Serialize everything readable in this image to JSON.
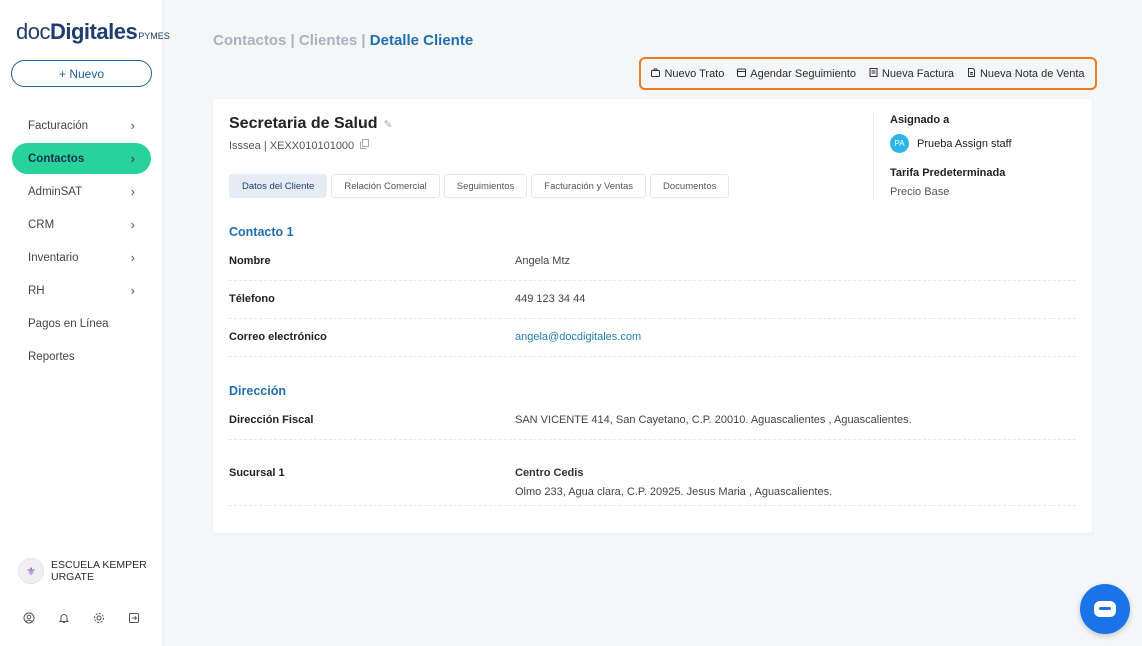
{
  "sidebar": {
    "logo": {
      "doc": "doc",
      "digitales": "Digitales",
      "pymes": "PYMES"
    },
    "new_button": "+ Nuevo",
    "items": [
      {
        "label": "Facturación",
        "chevron": "›"
      },
      {
        "label": "Contactos",
        "chevron": "›"
      },
      {
        "label": "AdminSAT",
        "chevron": "›"
      },
      {
        "label": "CRM",
        "chevron": "›"
      },
      {
        "label": "Inventario",
        "chevron": "›"
      },
      {
        "label": "RH",
        "chevron": "›"
      },
      {
        "label": "Pagos en Línea",
        "chevron": ""
      },
      {
        "label": "Reportes",
        "chevron": ""
      }
    ],
    "active_item": "Contactos",
    "organization": "ESCUELA KEMPER URGATE",
    "footer_icons": [
      "user-circle-icon",
      "bell-icon",
      "gear-icon",
      "logout-icon"
    ]
  },
  "breadcrumb": {
    "part1": "Contactos",
    "sep1": " | ",
    "part2": "Clientes",
    "sep2": " | ",
    "current": "Detalle Cliente"
  },
  "actions": [
    {
      "label": "Nuevo Trato",
      "icon": "briefcase-icon"
    },
    {
      "label": "Agendar Seguimiento",
      "icon": "calendar-icon"
    },
    {
      "label": "Nueva Factura",
      "icon": "invoice-icon"
    },
    {
      "label": "Nueva Nota de Venta",
      "icon": "receipt-icon"
    }
  ],
  "client": {
    "name": "Secretaria de Salud",
    "subtitle": "Isssea | XEXX010101000"
  },
  "tabs": [
    {
      "label": "Datos del Cliente"
    },
    {
      "label": "Relación Comercial"
    },
    {
      "label": "Seguimientos"
    },
    {
      "label": "Facturación y Ventas"
    },
    {
      "label": "Documentos"
    }
  ],
  "assign": {
    "label": "Asignado a",
    "initials": "PA",
    "name": "Prueba Assign staff",
    "tarifa_label": "Tarifa Predeterminada",
    "tarifa_value": "Precio Base"
  },
  "contacto": {
    "title": "Contacto 1",
    "rows": [
      {
        "label": "Nombre",
        "value": "Angela Mtz"
      },
      {
        "label": "Télefono",
        "value": "449 123 34 44"
      },
      {
        "label": "Correo electrónico",
        "value": "angela@docdigitales.com"
      }
    ]
  },
  "direccion": {
    "title": "Dirección",
    "fiscal_label": "Dirección Fiscal",
    "fiscal_value": "SAN VICENTE 414, San Cayetano, C.P. 20010. Aguascalientes , Aguascalientes.",
    "sucursal_label": "Sucursal 1",
    "sucursal_name": "Centro Cedis",
    "sucursal_value": "Olmo 233, Agua clara, C.P. 20925. Jesus Maria , Aguascalientes."
  }
}
